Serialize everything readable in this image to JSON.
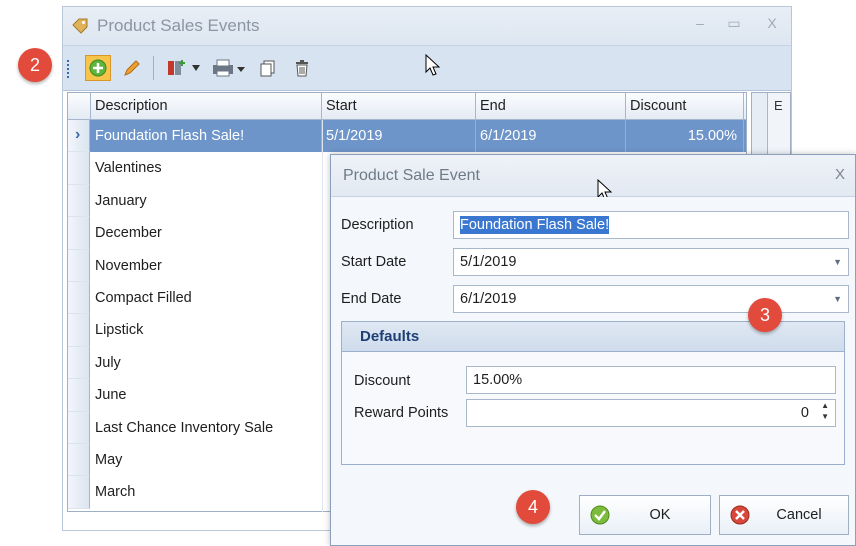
{
  "window": {
    "title": "Product Sales Events",
    "minimize_glyph": "–",
    "maximize_glyph": "▭",
    "close_glyph": "X"
  },
  "toolbar": {
    "buttons": [
      "add-icon",
      "edit-pencil-icon",
      "columns-icon",
      "dropdown-icon",
      "print-icon",
      "copy-icon",
      "delete-trash-icon"
    ]
  },
  "grid": {
    "columns": [
      "Description",
      "Start",
      "End",
      "Discount"
    ],
    "selected_indicator": "›",
    "rows": [
      {
        "description": "Foundation Flash Sale!",
        "start": "5/1/2019",
        "end": "6/1/2019",
        "discount": "15.00%"
      },
      {
        "description": "Valentines"
      },
      {
        "description": "January"
      },
      {
        "description": "December"
      },
      {
        "description": "November"
      },
      {
        "description": "Compact Filled"
      },
      {
        "description": "Lipstick"
      },
      {
        "description": "July"
      },
      {
        "description": "June"
      },
      {
        "description": "Last Chance Inventory Sale"
      },
      {
        "description": "May"
      },
      {
        "description": "March"
      }
    ],
    "side_header_fragment": "E"
  },
  "dialog": {
    "title": "Product Sale Event",
    "close_glyph": "X",
    "fields": {
      "description_label": "Description",
      "description_value": "Foundation Flash Sale!",
      "start_label": "Start Date",
      "start_value": "5/1/2019",
      "end_label": "End Date",
      "end_value": "6/1/2019"
    },
    "defaults": {
      "header": "Defaults",
      "discount_label": "Discount",
      "discount_value": "15.00%",
      "reward_label": "Reward Points",
      "reward_value": "0"
    },
    "ok_label": "OK",
    "cancel_label": "Cancel"
  },
  "callouts": {
    "two": "2",
    "three": "3",
    "four": "4"
  },
  "colors": {
    "selection": "#6e95c9",
    "callout": "#e24a3b",
    "defaults_header_text": "#1f3f74"
  }
}
